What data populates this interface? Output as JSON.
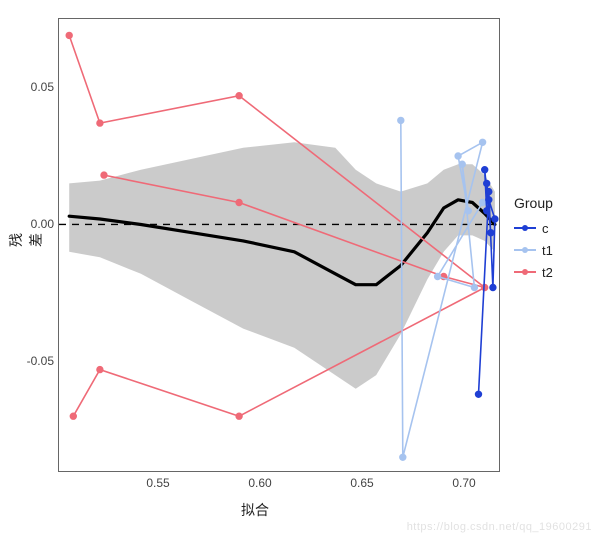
{
  "chart_data": {
    "type": "line",
    "title": "",
    "xlabel": "拟合",
    "ylabel": "残差",
    "xlim": [
      0.505,
      0.72
    ],
    "ylim": [
      -0.09,
      0.075
    ],
    "x_ticks": [
      0.55,
      0.6,
      0.65,
      0.7
    ],
    "y_ticks": [
      -0.05,
      0.0,
      0.05
    ],
    "grid": false,
    "legend_position": "right",
    "reference_line": {
      "y": 0.0,
      "style": "dashed",
      "color": "#000000"
    },
    "smooth_curve": {
      "x": [
        0.51,
        0.525,
        0.545,
        0.57,
        0.595,
        0.62,
        0.64,
        0.65,
        0.66,
        0.672,
        0.685,
        0.693,
        0.7,
        0.707,
        0.713,
        0.718
      ],
      "y": [
        0.003,
        0.002,
        0.0,
        -0.003,
        -0.006,
        -0.01,
        -0.018,
        -0.022,
        -0.022,
        -0.015,
        -0.003,
        0.006,
        0.009,
        0.008,
        0.004,
        0.0
      ],
      "lo": [
        -0.01,
        -0.012,
        -0.018,
        -0.028,
        -0.038,
        -0.045,
        -0.055,
        -0.06,
        -0.055,
        -0.04,
        -0.02,
        -0.01,
        -0.004,
        -0.004,
        -0.006,
        -0.01
      ],
      "hi": [
        0.015,
        0.016,
        0.02,
        0.024,
        0.028,
        0.03,
        0.028,
        0.02,
        0.015,
        0.012,
        0.015,
        0.02,
        0.022,
        0.022,
        0.018,
        0.012
      ],
      "color": "#000000",
      "ribbon_color": "#bfbfbfb3"
    },
    "series": [
      {
        "name": "c",
        "color": "#1f3fd4",
        "x": [
          0.71,
          0.715,
          0.717,
          0.718,
          0.715,
          0.714,
          0.716,
          0.713,
          0.714
        ],
        "y": [
          -0.062,
          0.012,
          -0.023,
          0.002,
          0.009,
          0.015,
          -0.003,
          0.02,
          0.005
        ]
      },
      {
        "name": "t1",
        "color": "#a6c3ef",
        "x": [
          0.672,
          0.673,
          0.712,
          0.7,
          0.705,
          0.702,
          0.708,
          0.69,
          0.712
        ],
        "y": [
          0.038,
          -0.085,
          0.03,
          0.025,
          0.005,
          0.022,
          -0.023,
          -0.019,
          0.008
        ]
      },
      {
        "name": "t2",
        "color": "#ef6a77",
        "x": [
          0.51,
          0.525,
          0.527,
          0.593,
          0.593,
          0.593,
          0.693,
          0.713,
          0.512,
          0.525
        ],
        "y": [
          0.069,
          0.037,
          0.018,
          0.047,
          0.008,
          -0.07,
          -0.019,
          -0.023,
          -0.07,
          -0.053
        ]
      }
    ],
    "series_line_order": {
      "c": [
        0,
        1,
        2,
        3,
        4,
        5,
        6,
        7,
        8
      ],
      "t1": [
        0,
        1,
        2,
        3,
        4,
        5,
        6,
        7,
        8
      ],
      "t2_upper": [
        0,
        1,
        3,
        7
      ],
      "t2_mid": [
        2,
        4,
        6,
        7
      ],
      "t2_lower": [
        8,
        9,
        5,
        7
      ]
    }
  },
  "legend": {
    "title": "Group",
    "items": [
      {
        "label": "c",
        "color": "#1f3fd4"
      },
      {
        "label": "t1",
        "color": "#a6c3ef"
      },
      {
        "label": "t2",
        "color": "#ef6a77"
      }
    ]
  },
  "watermark": "https://blog.csdn.net/qq_19600291"
}
